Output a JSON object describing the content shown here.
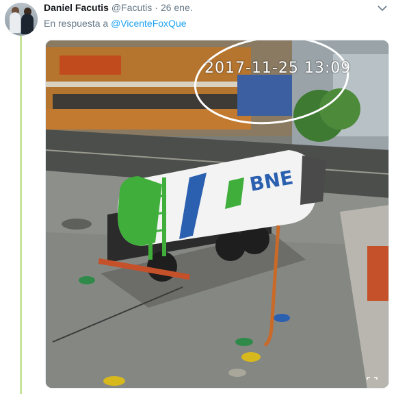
{
  "tweet": {
    "display_name": "Daniel Facutis",
    "handle": "@Facutis",
    "separator": "·",
    "time": "26 ene.",
    "reply_prefix": "En respuesta a",
    "reply_handle": "@VicenteFoxQue"
  },
  "media": {
    "timestamp_overlay": "2017-11-25 13:09",
    "truck_brand": "BNE",
    "colors": {
      "truck_green": "#3fae3a",
      "truck_blue": "#2b5fb0",
      "hose_orange": "#c96a28"
    }
  },
  "icons": {
    "menu": "chevron-down-icon",
    "fullscreen": "expand-icon",
    "avatar": "profile-photo"
  },
  "colors": {
    "thread_line": "#c6e59b",
    "link": "#1da1f2",
    "secondary_text": "#657786"
  }
}
